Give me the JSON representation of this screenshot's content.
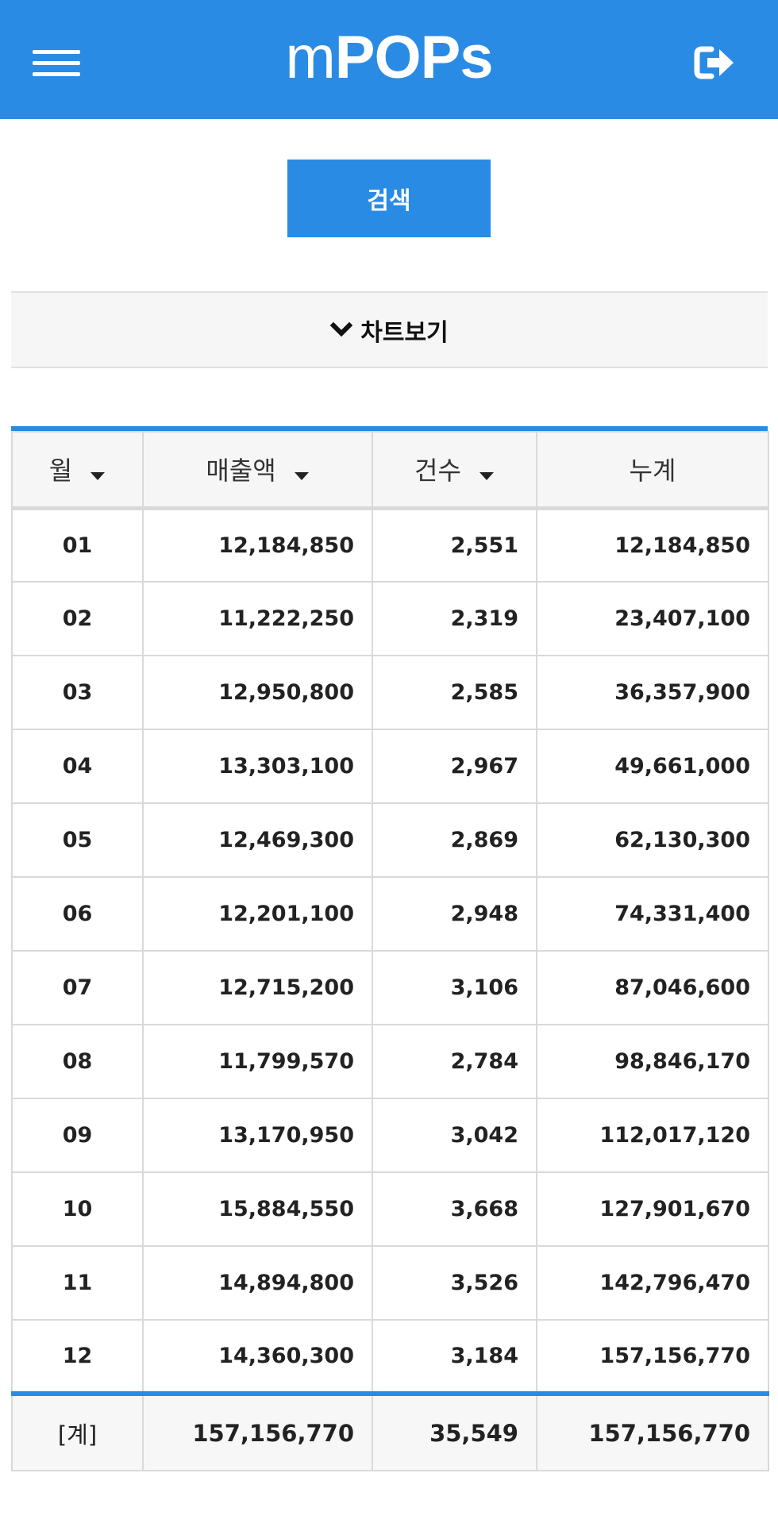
{
  "header": {
    "title": "mPOPs",
    "title_prefix": "m",
    "title_main": "POPs",
    "menu_icon": "hamburger-menu-icon",
    "logout_icon": "sign-out-icon"
  },
  "search": {
    "label": "검색"
  },
  "chart_toggle": {
    "label": "차트보기",
    "icon": "chevron-down-icon"
  },
  "table": {
    "columns": [
      {
        "label": "월",
        "sortable": true
      },
      {
        "label": "매출액",
        "sortable": true
      },
      {
        "label": "건수",
        "sortable": true
      },
      {
        "label": "누계",
        "sortable": false
      }
    ],
    "rows": [
      {
        "month": "01",
        "sales": "12,184,850",
        "count": "2,551",
        "cumulative": "12,184,850"
      },
      {
        "month": "02",
        "sales": "11,222,250",
        "count": "2,319",
        "cumulative": "23,407,100"
      },
      {
        "month": "03",
        "sales": "12,950,800",
        "count": "2,585",
        "cumulative": "36,357,900"
      },
      {
        "month": "04",
        "sales": "13,303,100",
        "count": "2,967",
        "cumulative": "49,661,000"
      },
      {
        "month": "05",
        "sales": "12,469,300",
        "count": "2,869",
        "cumulative": "62,130,300"
      },
      {
        "month": "06",
        "sales": "12,201,100",
        "count": "2,948",
        "cumulative": "74,331,400"
      },
      {
        "month": "07",
        "sales": "12,715,200",
        "count": "3,106",
        "cumulative": "87,046,600"
      },
      {
        "month": "08",
        "sales": "11,799,570",
        "count": "2,784",
        "cumulative": "98,846,170"
      },
      {
        "month": "09",
        "sales": "13,170,950",
        "count": "3,042",
        "cumulative": "112,017,120"
      },
      {
        "month": "10",
        "sales": "15,884,550",
        "count": "3,668",
        "cumulative": "127,901,670"
      },
      {
        "month": "11",
        "sales": "14,894,800",
        "count": "3,526",
        "cumulative": "142,796,470"
      },
      {
        "month": "12",
        "sales": "14,360,300",
        "count": "3,184",
        "cumulative": "157,156,770"
      }
    ],
    "total": {
      "label": "[계]",
      "sales": "157,156,770",
      "count": "35,549",
      "cumulative": "157,156,770"
    }
  },
  "colors": {
    "accent": "#2a8be4",
    "header_bg": "#f6f6f6",
    "border": "#d9d9d9"
  }
}
